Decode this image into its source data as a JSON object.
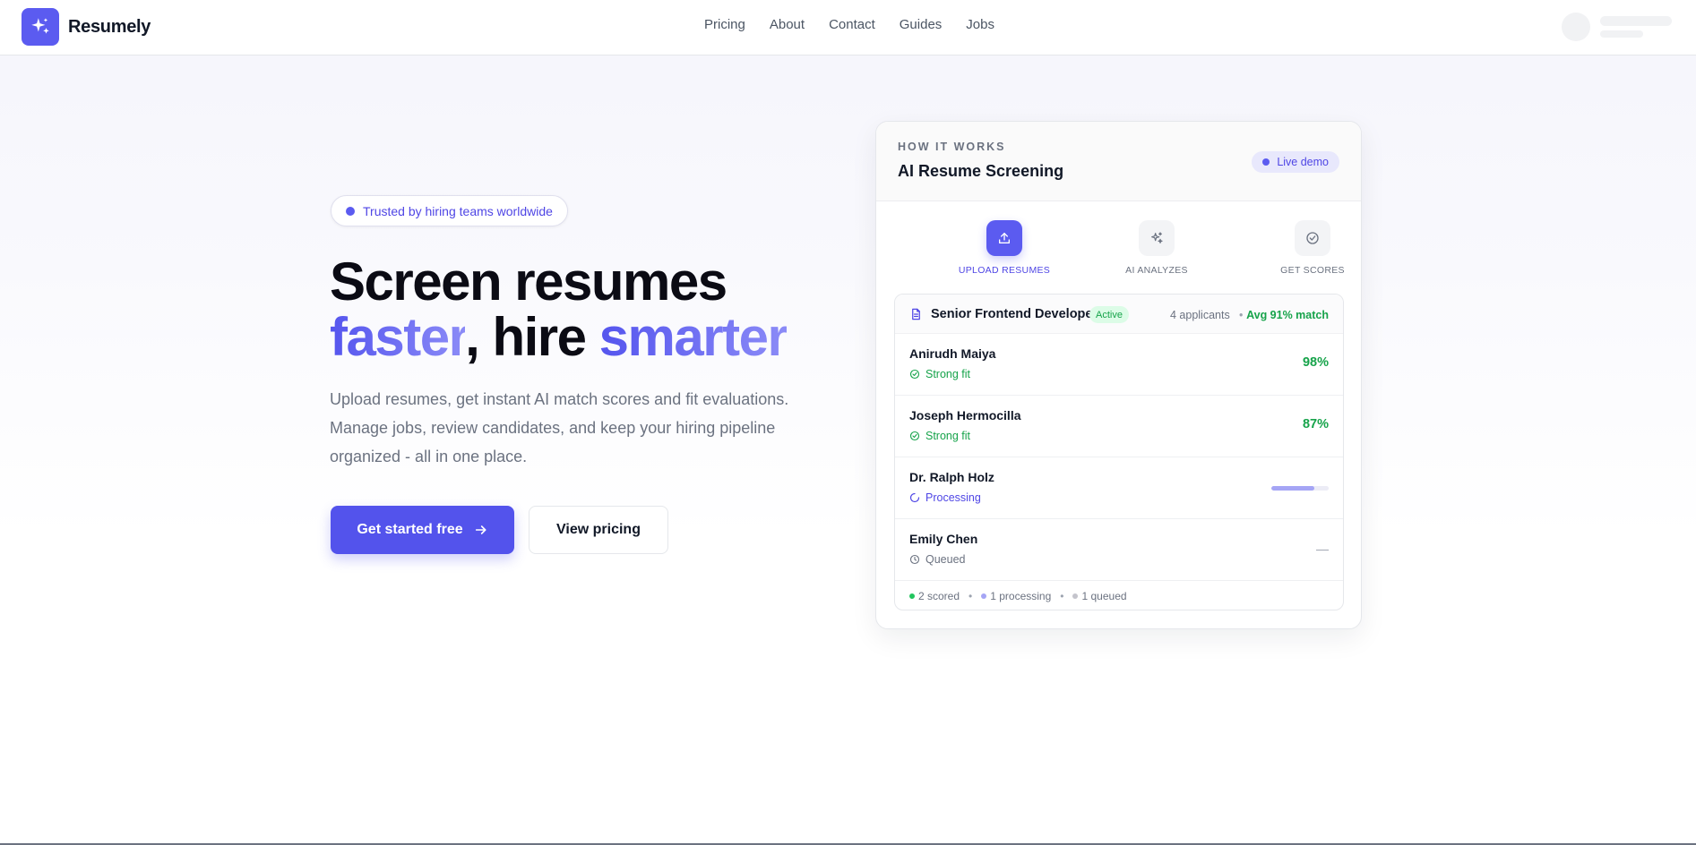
{
  "brand": {
    "name": "Resumely",
    "logo_icon": "sparkles-icon",
    "accent": "#5b5bf0"
  },
  "nav": {
    "items": [
      "Pricing",
      "About",
      "Contact",
      "Guides",
      "Jobs"
    ]
  },
  "hero": {
    "badge": "Trusted by hiring teams worldwide",
    "headline_line1": "Screen resumes",
    "headline_word_a": "faster",
    "headline_mid": ", hire ",
    "headline_word_b": "smarter",
    "subtext": "Upload resumes, get instant AI match scores and fit evaluations. Manage jobs, review candidates, and keep your hiring pipeline organized - all in one place.",
    "primary_cta": "Get started free",
    "secondary_cta": "View pricing"
  },
  "demo": {
    "eyebrow": "HOW IT WORKS",
    "title": "AI Resume Screening",
    "live_label": "Live demo",
    "steps": [
      {
        "label": "UPLOAD RESUMES",
        "icon": "upload-icon",
        "active": true
      },
      {
        "label": "AI ANALYZES",
        "icon": "sparkles-icon",
        "active": false
      },
      {
        "label": "GET SCORES",
        "icon": "check-circle-icon",
        "active": false
      }
    ],
    "job": {
      "title": "Senior Frontend Developer",
      "status": "Active",
      "applicants": "4 applicants",
      "separator": "•",
      "avg_match": "Avg 91% match"
    },
    "candidates": [
      {
        "name": "Anirudh Maiya",
        "status": "Strong fit",
        "score": "98%"
      },
      {
        "name": "Joseph Hermocilla",
        "status": "Strong fit",
        "score": "87%"
      },
      {
        "name": "Dr. Ralph Holz",
        "status": "Processing",
        "progress": 0.75
      },
      {
        "name": "Emily Chen",
        "status": "Queued",
        "score": "—"
      }
    ],
    "summary": {
      "scored": "2 scored",
      "processing": "1 processing",
      "queued": "1 queued",
      "separator": "•"
    }
  },
  "colors": {
    "green": "#16a34a",
    "indigo": "#4f46e5",
    "gray": "#6b7280"
  }
}
